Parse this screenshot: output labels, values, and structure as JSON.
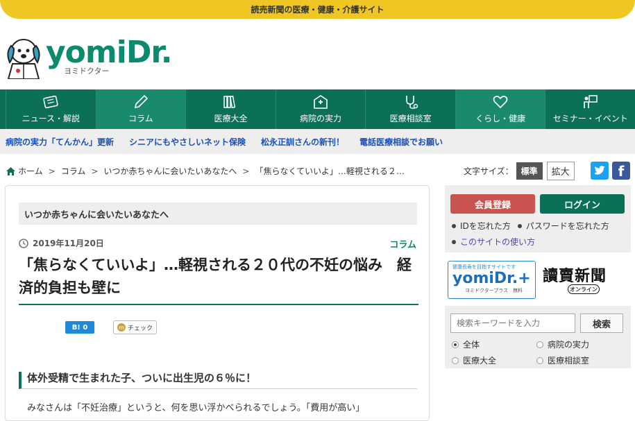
{
  "topbar": {
    "text": "読売新聞の医療・健康・介護サイト"
  },
  "logo": {
    "wordmark": "yomiDr.",
    "subtitle": "ヨミドクター"
  },
  "nav": [
    {
      "label": "ニュース・解説",
      "icon": "newspaper-icon",
      "active": true
    },
    {
      "label": "コラム",
      "icon": "pencil-icon",
      "active": true
    },
    {
      "label": "医療大全",
      "icon": "books-icon",
      "active": false
    },
    {
      "label": "病院の実力",
      "icon": "hospital-icon",
      "active": false
    },
    {
      "label": "医療相談室",
      "icon": "stethoscope-icon",
      "active": false
    },
    {
      "label": "くらし・健康",
      "icon": "heart-icon",
      "active": true
    },
    {
      "label": "セミナー・イベント",
      "icon": "lecture-icon",
      "active": false
    }
  ],
  "subnav": [
    "病院の実力「てんかん」更新",
    "シニアにもやさしいネット保険",
    "松永正訓さんの新刊！",
    "電話医療相談でお願い"
  ],
  "breadcrumb": {
    "home": "ホーム",
    "items": [
      "コラム",
      "いつか赤ちゃんに会いたいあなたへ",
      "「焦らなくていいよ」…軽視される２…"
    ]
  },
  "fontsize": {
    "label": "文字サイズ：",
    "standard": "標準",
    "large": "拡大"
  },
  "social": {
    "facebook": "f"
  },
  "article": {
    "series": "いつか赤ちゃんに会いたいあなたへ",
    "date": "2019年11月20日",
    "category": "コラム",
    "title": "「焦らなくていいよ」…軽視される２０代の不妊の悩み　経済的負担も壁に",
    "hatena": "B! 0",
    "check": "チェック",
    "heading": "体外受精で生まれた子、ついに出生児の６％に！",
    "body": "みなさんは「不妊治療」というと、何を思い浮かべられるでしょう。「費用が高い」"
  },
  "member": {
    "register": "会員登録",
    "login": "ログイン",
    "forgot_id": "IDを忘れた方",
    "forgot_pw": "パスワードを忘れた方",
    "howto": "このサイトの使い方"
  },
  "banners": {
    "plus_tagline": "健康長寿を目指すサイトです",
    "plus_wordmark": "yomiDr.+",
    "plus_sub": "ヨミドクタープラス　無料",
    "yomiuri": "讀賣新聞",
    "online": "オンライン"
  },
  "search": {
    "placeholder": "検索キーワードを入力",
    "button": "検索",
    "options": [
      "全体",
      "病院の実力",
      "医療大全",
      "医療相談室"
    ],
    "selected": "全体"
  },
  "colors": {
    "brand_green": "#0c6f58",
    "accent_yellow": "#f0c623",
    "register_red": "#c9534f"
  }
}
